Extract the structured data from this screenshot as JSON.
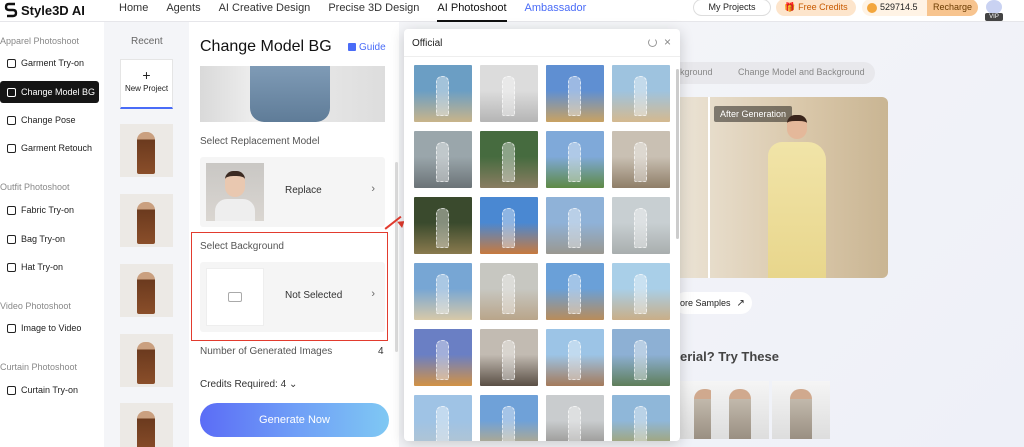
{
  "app": {
    "logo_text": "Style3D AI"
  },
  "nav": {
    "links": [
      {
        "label": "Home"
      },
      {
        "label": "Agents"
      },
      {
        "label": "AI Creative Design"
      },
      {
        "label": "Precise 3D Design"
      },
      {
        "label": "AI Photoshoot"
      },
      {
        "label": "Ambassador"
      }
    ],
    "active": "AI Photoshoot",
    "my_projects": "My Projects",
    "free_credits": "Free Credits",
    "credit_balance": "529714.5",
    "recharge": "Recharge",
    "vip": "VIP"
  },
  "sidebar": {
    "sections": [
      {
        "heading": "Apparel Photoshoot",
        "items": [
          "Garment Try-on",
          "Change Model BG",
          "Change Pose",
          "Garment Retouch"
        ]
      },
      {
        "heading": "Outfit Photoshoot",
        "items": [
          "Fabric Try-on",
          "Bag Try-on",
          "Hat Try-on"
        ]
      },
      {
        "heading": "Video Photoshoot",
        "items": [
          "Image to Video"
        ]
      },
      {
        "heading": "Curtain Photoshoot",
        "items": [
          "Curtain Try-on"
        ]
      }
    ],
    "active_item": "Change Model BG"
  },
  "recent": {
    "title": "Recent",
    "new_project": "New Project"
  },
  "panel": {
    "title": "Change Model BG",
    "guide": "Guide",
    "select_model_label": "Select Replacement Model",
    "replace_label": "Replace",
    "select_background_label": "Select Background",
    "not_selected_label": "Not Selected",
    "num_images_label": "Number of Generated Images",
    "num_images_value": "4",
    "credits_required": "Credits Required: 4",
    "generate_button": "Generate Now"
  },
  "modal": {
    "title": "Official",
    "backgrounds": [
      {
        "colors": [
          "#6b9ec4",
          "#c9b48a"
        ]
      },
      {
        "colors": [
          "#dcdcdc",
          "#b5b5b5"
        ]
      },
      {
        "colors": [
          "#5f8fd2",
          "#c9a262"
        ]
      },
      {
        "colors": [
          "#9ec3df",
          "#d4b98f"
        ]
      },
      {
        "colors": [
          "#9aa6ab",
          "#6b7377"
        ]
      },
      {
        "colors": [
          "#466b3f",
          "#8a7d62"
        ]
      },
      {
        "colors": [
          "#7fa9d9",
          "#5e8a45"
        ]
      },
      {
        "colors": [
          "#c9c0b3",
          "#8f7e68"
        ]
      },
      {
        "colors": [
          "#3a4a2d",
          "#8a7a4e"
        ]
      },
      {
        "colors": [
          "#4a88d2",
          "#c77a3f"
        ]
      },
      {
        "colors": [
          "#8fb2d8",
          "#9a9890"
        ]
      },
      {
        "colors": [
          "#c8cfd2",
          "#a9aeae"
        ]
      },
      {
        "colors": [
          "#77a6d4",
          "#d8c9a8"
        ]
      },
      {
        "colors": [
          "#c7c7c1",
          "#b9a58a"
        ]
      },
      {
        "colors": [
          "#6aa0d8",
          "#b98c5a"
        ]
      },
      {
        "colors": [
          "#a9cfe8",
          "#c9ae87"
        ]
      },
      {
        "colors": [
          "#6a7fc4",
          "#d29245"
        ]
      },
      {
        "colors": [
          "#c2bbb2",
          "#5a4f45"
        ]
      },
      {
        "colors": [
          "#9cc4e6",
          "#a47a5b"
        ]
      },
      {
        "colors": [
          "#8db0d4",
          "#5f7e5a"
        ]
      },
      {
        "colors": [
          "#9fc3e5",
          "#b6c4cd"
        ]
      },
      {
        "colors": [
          "#6fa1d8",
          "#c9ac74"
        ]
      },
      {
        "colors": [
          "#c9ccce",
          "#8a8783"
        ]
      },
      {
        "colors": [
          "#8fb7d9",
          "#a99f55"
        ]
      }
    ]
  },
  "right": {
    "tab_background": "kground",
    "tab_model_bg": "Change Model and Background",
    "after_generation": "After Generation",
    "more_samples": "ore Samples",
    "try_these": "erial? Try These"
  },
  "colors": {
    "accent": "#4a6cf7",
    "annotation_red": "#e23b2e",
    "active_bg": "#151515"
  }
}
